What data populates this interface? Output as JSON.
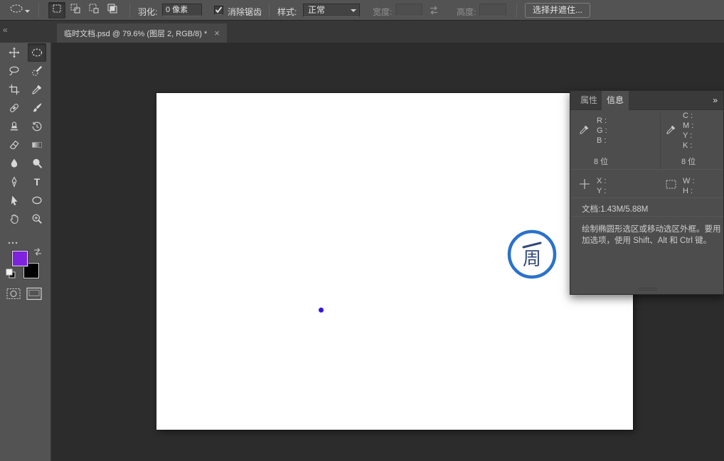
{
  "options_bar": {
    "tool_preset_icon": "ellipse-marquee",
    "selection_modes": [
      "new-selection",
      "add-to-selection",
      "subtract-from-selection",
      "intersect-selection"
    ],
    "feather": {
      "label": "羽化:",
      "value": "0 像素"
    },
    "antialias": {
      "label": "消除锯齿",
      "checked": true
    },
    "style": {
      "label": "样式:",
      "value": "正常"
    },
    "width": {
      "label": "宽度:",
      "value": ""
    },
    "height": {
      "label": "高度:",
      "value": ""
    },
    "select_and_mask_button": "选择并遮住..."
  },
  "tab_bar": {
    "collapse_glyph": "«",
    "document_tab": "临时文档.psd @ 79.6% (图层 2, RGB/8) *",
    "close_glyph": "×"
  },
  "toolbar": {
    "tools": [
      "move",
      "ellipse-marquee",
      "lasso",
      "quick-selection",
      "crop",
      "eyedropper",
      "spot-healing",
      "brush",
      "clone-stamp",
      "history-brush",
      "eraser",
      "gradient",
      "blur",
      "dodge",
      "pen",
      "type",
      "path-selection",
      "ellipse-shape",
      "hand",
      "zoom"
    ],
    "selected_tool": "ellipse-marquee",
    "type_glyph": "T",
    "foreground_color": "#7e22dd",
    "background_color": "#000000"
  },
  "canvas": {
    "dot_color": "#3715e0",
    "logo": {
      "ring_color": "#2a72cc",
      "glyph": "周",
      "glyph_color": "#33497c"
    }
  },
  "info_panel": {
    "tabs": [
      {
        "label": "属性"
      },
      {
        "label": "信息"
      }
    ],
    "active_tab": "信息",
    "menu_glyph": "»",
    "rgb": {
      "labels": [
        "R :",
        "G :",
        "B :"
      ],
      "bit_depth": "8 位"
    },
    "cmyk": {
      "labels": [
        "C :",
        "M :",
        "Y :",
        "K :"
      ],
      "bit_depth": "8 位"
    },
    "xy": {
      "labels": [
        "X :",
        "Y :"
      ]
    },
    "wh": {
      "labels": [
        "W :",
        "H :"
      ]
    },
    "document_size": "文档:1.43M/5.88M",
    "hint_line1": "绘制椭圆形选区或移动选区外框。要用",
    "hint_line2": "加选项，使用 Shift、Alt 和 Ctrl 键。"
  }
}
